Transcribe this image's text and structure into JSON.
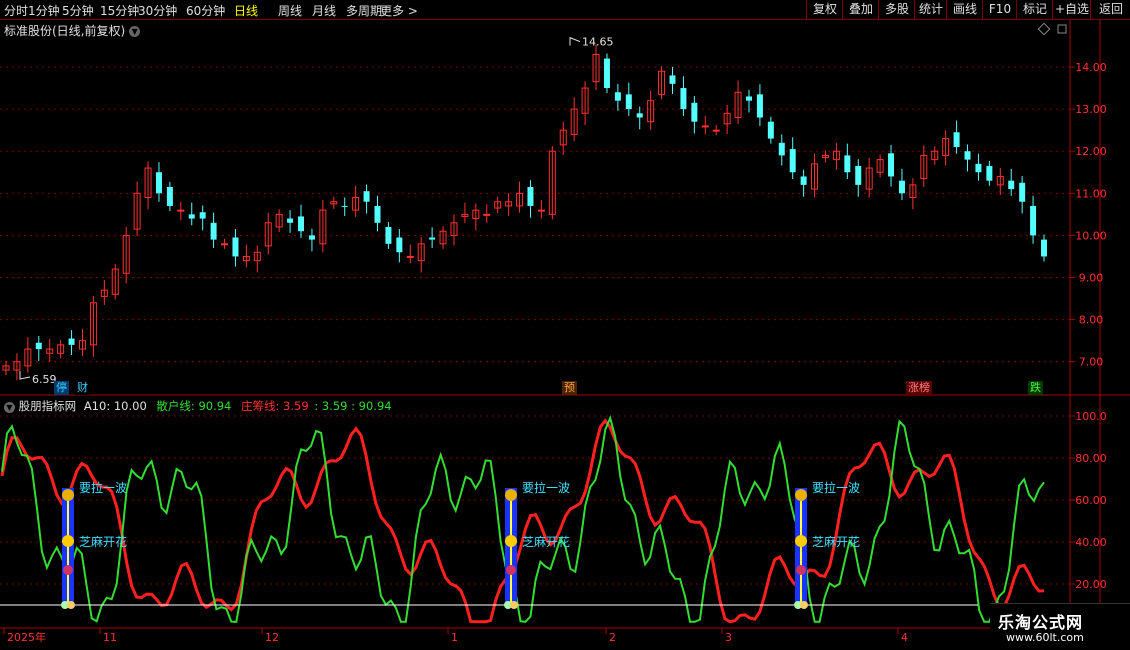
{
  "toolbar": {
    "periods": [
      "分时",
      "1分钟",
      "5分钟",
      "15分钟",
      "30分钟",
      "60分钟",
      "日线",
      "周线",
      "月线",
      "多周期",
      "更多 >"
    ],
    "active_period": "日线",
    "right_buttons": [
      "复权",
      "叠加",
      "多股",
      "统计",
      "画线",
      "F10",
      "标记",
      "+自选",
      "返回"
    ]
  },
  "main_chart": {
    "title": "标准股份(日线,前复权)",
    "high_label": "14.65",
    "low_label": "6.59",
    "y_ticks": [
      "14.00",
      "13.00",
      "12.00",
      "11.00",
      "10.00",
      "9.00",
      "8.00",
      "7.00"
    ],
    "event_tags": [
      {
        "text": "停",
        "color": "#3ad0ff",
        "bg": "#003a6a"
      },
      {
        "text": "财",
        "color": "#3ad0ff",
        "bg": "#000"
      },
      {
        "text": "预",
        "color": "#ffa040",
        "bg": "#4a2400"
      },
      {
        "text": "涨榜",
        "color": "#ff8080",
        "bg": "#5a0000"
      },
      {
        "text": "跌",
        "color": "#40ff40",
        "bg": "#003a00"
      }
    ]
  },
  "indicator": {
    "name": "股朋指标网",
    "a10_label": "A10: 10.00",
    "retail_label": "散户线: 90.94",
    "banker_label": "庄筹线: 3.59",
    "extra_values": ": 3.59 : 90.94",
    "y_ticks": [
      "100.0",
      "80.00",
      "60.00",
      "40.00",
      "20.00"
    ],
    "signal_label_1": "要拉一波",
    "signal_label_2": "芝麻开花",
    "colors": {
      "retail": "#33dd33",
      "banker": "#ff2020",
      "signal_bar": "#1a33ff",
      "baseline": "#ffffff"
    }
  },
  "time_axis": {
    "labels": [
      "2025年",
      "11",
      "12",
      "1",
      "2",
      "3",
      "4"
    ]
  },
  "watermark": {
    "line1": "乐淘公式网",
    "line2": "www.60lt.com"
  },
  "chart_data": {
    "type": "candlestick",
    "title": "标准股份(日线,前复权)",
    "close_approx": [
      6.9,
      7.0,
      7.3,
      7.3,
      7.3,
      7.4,
      7.4,
      7.5,
      8.4,
      8.7,
      9.2,
      10.0,
      11.0,
      11.6,
      11.0,
      10.7,
      10.6,
      10.4,
      10.4,
      9.9,
      9.8,
      9.5,
      9.5,
      9.6,
      10.3,
      10.5,
      10.3,
      10.1,
      9.9,
      10.6,
      10.8,
      10.7,
      10.9,
      10.8,
      10.3,
      9.8,
      9.6,
      9.5,
      9.8,
      9.9,
      10.1,
      10.3,
      10.5,
      10.6,
      10.5,
      10.8,
      10.8,
      11.0,
      10.7,
      10.6,
      12.0,
      12.5,
      13.0,
      13.5,
      14.3,
      13.5,
      13.2,
      13.0,
      12.8,
      13.2,
      13.9,
      13.6,
      13.0,
      12.7,
      12.6,
      12.5,
      12.9,
      13.4,
      13.2,
      12.8,
      12.3,
      11.9,
      11.5,
      11.2,
      11.7,
      11.9,
      12.0,
      11.5,
      11.2,
      11.6,
      11.8,
      11.4,
      11.0,
      11.2,
      11.9,
      12.0,
      12.3,
      12.1,
      11.8,
      11.5,
      11.3,
      11.4,
      11.1,
      10.8,
      10.0,
      9.5
    ],
    "y_axis_range": [
      6.5,
      15.0
    ],
    "indicator_series": [
      {
        "name": "散户线",
        "color": "#33dd33"
      },
      {
        "name": "庄筹线",
        "color": "#ff2020"
      }
    ],
    "indicator_y_range": [
      0,
      100
    ]
  }
}
